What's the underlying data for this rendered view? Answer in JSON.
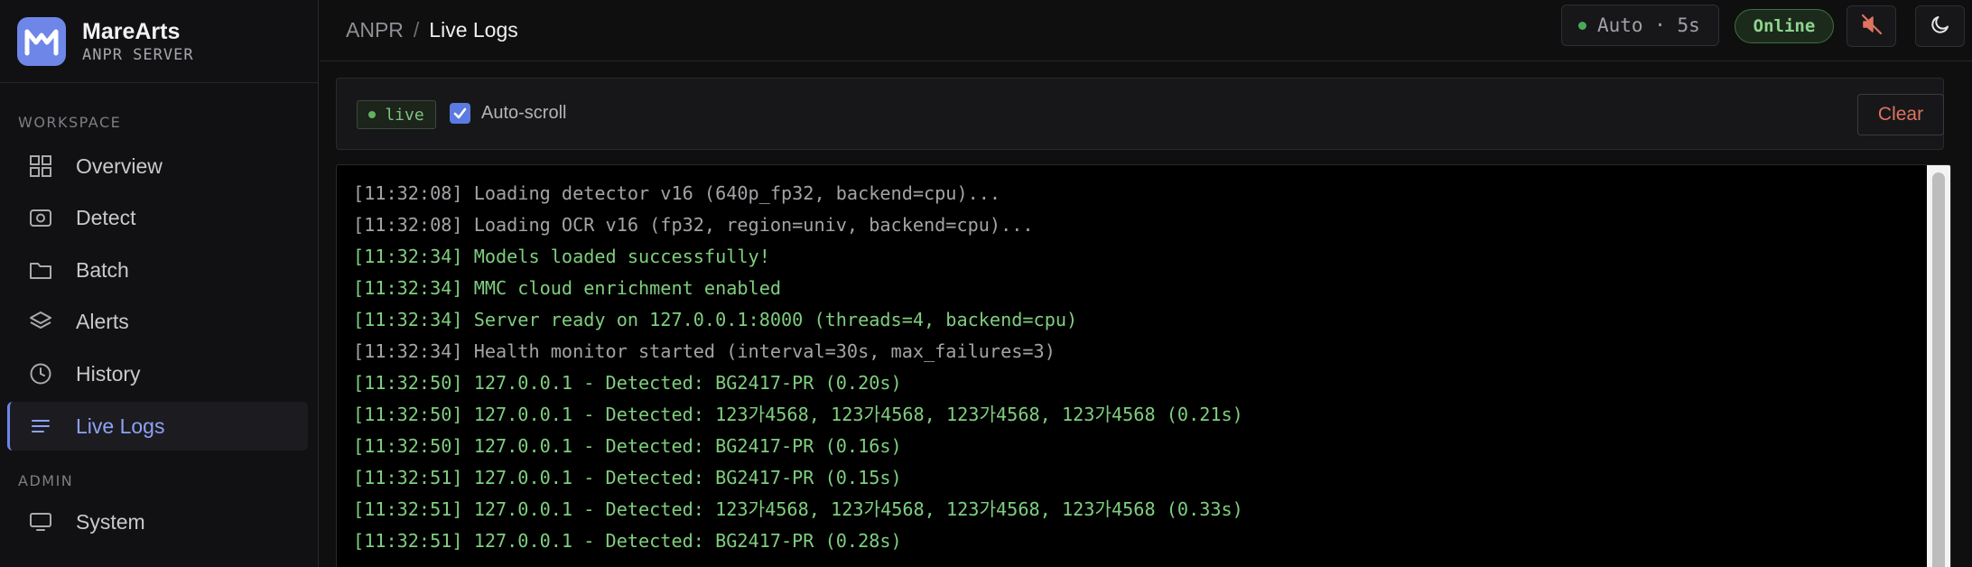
{
  "brand": {
    "name": "MareArts",
    "subtitle": "ANPR SERVER"
  },
  "sidebar": {
    "sections": [
      {
        "label": "WORKSPACE"
      },
      {
        "label": "ADMIN"
      }
    ],
    "items": [
      {
        "label": "Overview",
        "icon": "grid-icon"
      },
      {
        "label": "Detect",
        "icon": "camera-icon"
      },
      {
        "label": "Batch",
        "icon": "folder-icon"
      },
      {
        "label": "Alerts",
        "icon": "layers-icon"
      },
      {
        "label": "History",
        "icon": "clock-icon"
      },
      {
        "label": "Live Logs",
        "icon": "list-icon",
        "active": true
      },
      {
        "label": "System",
        "icon": "monitor-icon"
      }
    ]
  },
  "header": {
    "breadcrumb_root": "ANPR",
    "breadcrumb_sep": "/",
    "breadcrumb_current": "Live Logs",
    "auto_refresh": "Auto · 5s",
    "status": "Online",
    "mute_icon": "speaker-muted-icon",
    "theme_icon": "moon-icon"
  },
  "toolbar": {
    "live_label": "live",
    "autoscroll_label": "Auto-scroll",
    "autoscroll_checked": true,
    "clear_label": "Clear"
  },
  "colors": {
    "accent": "#6e86e8",
    "ok": "#7fce7f",
    "info": "#a3a3a8",
    "danger": "#e0735f"
  },
  "logs": [
    {
      "text": "[11:32:08] Loading detector v16 (640p_fp32, backend=cpu)...",
      "level": "info"
    },
    {
      "text": "[11:32:08] Loading OCR v16 (fp32, region=univ, backend=cpu)...",
      "level": "info"
    },
    {
      "text": "[11:32:34] Models loaded successfully!",
      "level": "ok"
    },
    {
      "text": "[11:32:34] MMC cloud enrichment enabled",
      "level": "ok"
    },
    {
      "text": "[11:32:34] Server ready on 127.0.0.1:8000 (threads=4, backend=cpu)",
      "level": "ok"
    },
    {
      "text": "[11:32:34] Health monitor started (interval=30s, max_failures=3)",
      "level": "info"
    },
    {
      "text": "[11:32:50] 127.0.0.1 - Detected: BG2417-PR (0.20s)",
      "level": "ok"
    },
    {
      "text": "[11:32:50] 127.0.0.1 - Detected: 123가4568, 123가4568, 123가4568, 123가4568 (0.21s)",
      "level": "ok"
    },
    {
      "text": "[11:32:50] 127.0.0.1 - Detected: BG2417-PR (0.16s)",
      "level": "ok"
    },
    {
      "text": "[11:32:51] 127.0.0.1 - Detected: BG2417-PR (0.15s)",
      "level": "ok"
    },
    {
      "text": "[11:32:51] 127.0.0.1 - Detected: 123가4568, 123가4568, 123가4568, 123가4568 (0.33s)",
      "level": "ok"
    },
    {
      "text": "[11:32:51] 127.0.0.1 - Detected: BG2417-PR (0.28s)",
      "level": "ok"
    }
  ]
}
